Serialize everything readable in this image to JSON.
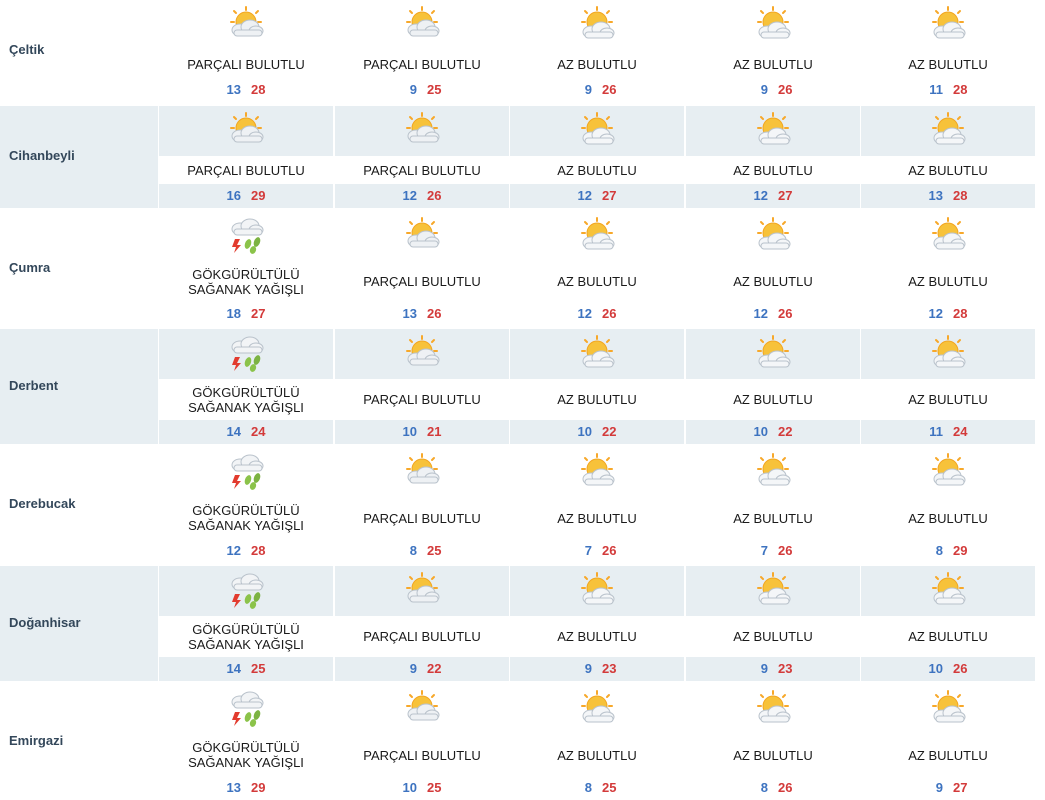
{
  "colors": {
    "min_temp": "#3d73c0",
    "max_temp": "#d33a3a",
    "shade": "#e7eef2",
    "city_text": "#33475a"
  },
  "rows": [
    {
      "city": "Çeltik",
      "days": [
        {
          "icon": "partly-cloudy-icon",
          "desc": [
            "PARÇALI BULUTLU"
          ],
          "min": "13",
          "max": "28"
        },
        {
          "icon": "partly-cloudy-icon",
          "desc": [
            "PARÇALI BULUTLU"
          ],
          "min": "9",
          "max": "25"
        },
        {
          "icon": "mostly-sunny-icon",
          "desc": [
            "AZ BULUTLU"
          ],
          "min": "9",
          "max": "26"
        },
        {
          "icon": "mostly-sunny-icon",
          "desc": [
            "AZ BULUTLU"
          ],
          "min": "9",
          "max": "26"
        },
        {
          "icon": "mostly-sunny-icon",
          "desc": [
            "AZ BULUTLU"
          ],
          "min": "11",
          "max": "28"
        }
      ]
    },
    {
      "city": "Cihanbeyli",
      "days": [
        {
          "icon": "partly-cloudy-icon",
          "desc": [
            "PARÇALI BULUTLU"
          ],
          "min": "16",
          "max": "29"
        },
        {
          "icon": "partly-cloudy-icon",
          "desc": [
            "PARÇALI BULUTLU"
          ],
          "min": "12",
          "max": "26"
        },
        {
          "icon": "mostly-sunny-icon",
          "desc": [
            "AZ BULUTLU"
          ],
          "min": "12",
          "max": "27"
        },
        {
          "icon": "mostly-sunny-icon",
          "desc": [
            "AZ BULUTLU"
          ],
          "min": "12",
          "max": "27"
        },
        {
          "icon": "mostly-sunny-icon",
          "desc": [
            "AZ BULUTLU"
          ],
          "min": "13",
          "max": "28"
        }
      ]
    },
    {
      "city": "Çumra",
      "days": [
        {
          "icon": "thunderstorm-icon",
          "desc": [
            "GÖKGÜRÜLTÜLÜ",
            "SAĞANAK YAĞIŞLI"
          ],
          "min": "18",
          "max": "27"
        },
        {
          "icon": "partly-cloudy-icon",
          "desc": [
            "PARÇALI BULUTLU"
          ],
          "min": "13",
          "max": "26"
        },
        {
          "icon": "mostly-sunny-icon",
          "desc": [
            "AZ BULUTLU"
          ],
          "min": "12",
          "max": "26"
        },
        {
          "icon": "mostly-sunny-icon",
          "desc": [
            "AZ BULUTLU"
          ],
          "min": "12",
          "max": "26"
        },
        {
          "icon": "mostly-sunny-icon",
          "desc": [
            "AZ BULUTLU"
          ],
          "min": "12",
          "max": "28"
        }
      ]
    },
    {
      "city": "Derbent",
      "days": [
        {
          "icon": "thunderstorm-icon",
          "desc": [
            "GÖKGÜRÜLTÜLÜ",
            "SAĞANAK YAĞIŞLI"
          ],
          "min": "14",
          "max": "24"
        },
        {
          "icon": "partly-cloudy-icon",
          "desc": [
            "PARÇALI BULUTLU"
          ],
          "min": "10",
          "max": "21"
        },
        {
          "icon": "mostly-sunny-icon",
          "desc": [
            "AZ BULUTLU"
          ],
          "min": "10",
          "max": "22"
        },
        {
          "icon": "mostly-sunny-icon",
          "desc": [
            "AZ BULUTLU"
          ],
          "min": "10",
          "max": "22"
        },
        {
          "icon": "mostly-sunny-icon",
          "desc": [
            "AZ BULUTLU"
          ],
          "min": "11",
          "max": "24"
        }
      ]
    },
    {
      "city": "Derebucak",
      "days": [
        {
          "icon": "thunderstorm-icon",
          "desc": [
            "GÖKGÜRÜLTÜLÜ",
            "SAĞANAK YAĞIŞLI"
          ],
          "min": "12",
          "max": "28"
        },
        {
          "icon": "partly-cloudy-icon",
          "desc": [
            "PARÇALI BULUTLU"
          ],
          "min": "8",
          "max": "25"
        },
        {
          "icon": "mostly-sunny-icon",
          "desc": [
            "AZ BULUTLU"
          ],
          "min": "7",
          "max": "26"
        },
        {
          "icon": "mostly-sunny-icon",
          "desc": [
            "AZ BULUTLU"
          ],
          "min": "7",
          "max": "26"
        },
        {
          "icon": "mostly-sunny-icon",
          "desc": [
            "AZ BULUTLU"
          ],
          "min": "8",
          "max": "29"
        }
      ]
    },
    {
      "city": "Doğanhisar",
      "days": [
        {
          "icon": "thunderstorm-icon",
          "desc": [
            "GÖKGÜRÜLTÜLÜ",
            "SAĞANAK YAĞIŞLI"
          ],
          "min": "14",
          "max": "25"
        },
        {
          "icon": "partly-cloudy-icon",
          "desc": [
            "PARÇALI BULUTLU"
          ],
          "min": "9",
          "max": "22"
        },
        {
          "icon": "mostly-sunny-icon",
          "desc": [
            "AZ BULUTLU"
          ],
          "min": "9",
          "max": "23"
        },
        {
          "icon": "mostly-sunny-icon",
          "desc": [
            "AZ BULUTLU"
          ],
          "min": "9",
          "max": "23"
        },
        {
          "icon": "mostly-sunny-icon",
          "desc": [
            "AZ BULUTLU"
          ],
          "min": "10",
          "max": "26"
        }
      ]
    },
    {
      "city": "Emirgazi",
      "days": [
        {
          "icon": "thunderstorm-icon",
          "desc": [
            "GÖKGÜRÜLTÜLÜ",
            "SAĞANAK YAĞIŞLI"
          ],
          "min": "13",
          "max": "29"
        },
        {
          "icon": "partly-cloudy-icon",
          "desc": [
            "PARÇALI BULUTLU"
          ],
          "min": "10",
          "max": "25"
        },
        {
          "icon": "mostly-sunny-icon",
          "desc": [
            "AZ BULUTLU"
          ],
          "min": "8",
          "max": "25"
        },
        {
          "icon": "mostly-sunny-icon",
          "desc": [
            "AZ BULUTLU"
          ],
          "min": "8",
          "max": "26"
        },
        {
          "icon": "mostly-sunny-icon",
          "desc": [
            "AZ BULUTLU"
          ],
          "min": "9",
          "max": "27"
        }
      ]
    }
  ]
}
